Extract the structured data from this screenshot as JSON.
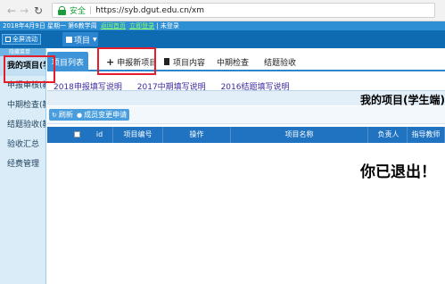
{
  "browser": {
    "secure_label": "安全",
    "url": "https://syb.dgut.edu.cn/xm"
  },
  "topstrip": {
    "date_text": "2018年4月9日 星期一 第6教学周",
    "link1": "返回首页",
    "link2": "立即登录",
    "tail": "| 未登录"
  },
  "header": {
    "fullscreen_label": "全屏流动",
    "project_menu_label": "项目"
  },
  "sidebar": {
    "hide_menu_label": "隐藏菜单",
    "items": [
      {
        "label": "我的项目(学"
      },
      {
        "label": "申报审核(教"
      },
      {
        "label": "中期检查(教"
      },
      {
        "label": "结题验收(教"
      },
      {
        "label": "验收汇总"
      },
      {
        "label": "经费管理"
      }
    ]
  },
  "tabs": [
    {
      "label": "项目列表"
    },
    {
      "label": "申报新项目"
    },
    {
      "label": "项目内容"
    },
    {
      "label": "中期检查"
    },
    {
      "label": "结题验收"
    }
  ],
  "links": [
    {
      "label": "2018申报填写说明"
    },
    {
      "label": "2017中期填写说明"
    },
    {
      "label": "2016结题填写说明"
    }
  ],
  "page_title": "我的项目(学生端)",
  "toolbar": {
    "refresh_label": "刷新",
    "change_label": "成员变更申请"
  },
  "table": {
    "columns": [
      "id",
      "项目编号",
      "操作",
      "项目名称",
      "负责人",
      "指导教师"
    ]
  },
  "message": "你已退出！",
  "colors": {
    "primary": "#1f73c0",
    "highlight_box": "#e41f2b"
  }
}
